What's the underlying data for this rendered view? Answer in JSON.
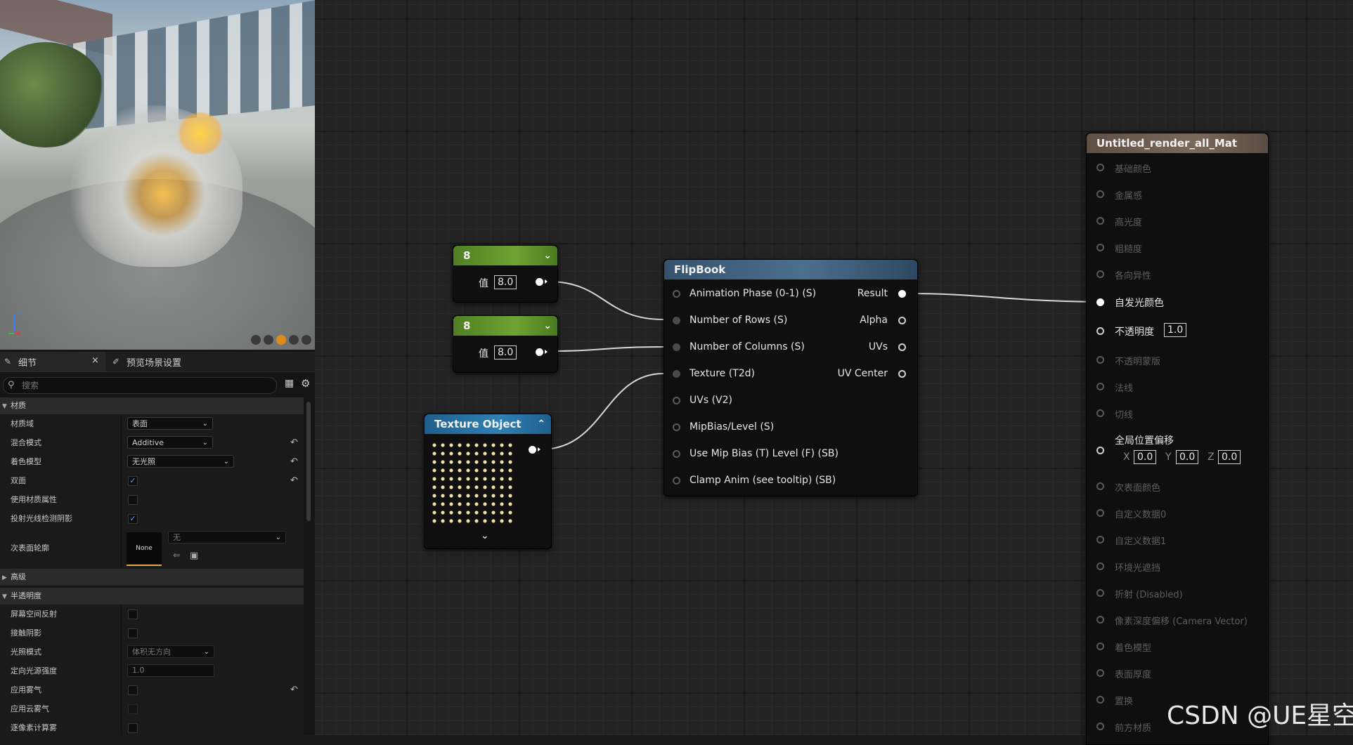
{
  "details_panel": {
    "tab_details": "细节",
    "tab_preview_scene": "预览场景设置",
    "search_placeholder": "搜索",
    "categories": {
      "material": "材质",
      "advanced": "高级",
      "translucency": "半透明度"
    },
    "rows": {
      "material_domain": {
        "label": "材质域",
        "value": "表面"
      },
      "blend_mode": {
        "label": "混合模式",
        "value": "Additive"
      },
      "shading_model": {
        "label": "着色模型",
        "value": "无光照"
      },
      "two_sided": {
        "label": "双面",
        "checked": true
      },
      "use_material_attributes": {
        "label": "使用材质属性",
        "checked": false
      },
      "cast_ray_traced_shadows": {
        "label": "投射光线检测阴影",
        "checked": true
      },
      "subsurface_profile": {
        "label": "次表面轮廓",
        "thumb": "None",
        "value": "无"
      },
      "screen_space_reflections": {
        "label": "屏幕空间反射",
        "checked": false
      },
      "contact_shadows": {
        "label": "接触阴影",
        "checked": false
      },
      "lighting_mode": {
        "label": "光照模式",
        "value": "体积无方向"
      },
      "directional_light_intensity": {
        "label": "定向光源强度",
        "value": "1.0"
      },
      "apply_fogging": {
        "label": "应用雾气",
        "checked": false
      },
      "apply_cloud_fogging": {
        "label": "应用云雾气",
        "checked": false
      },
      "per_pixel_fogging": {
        "label": "逐像素计算雾"
      }
    }
  },
  "graph": {
    "const1": {
      "title": "8",
      "label": "值",
      "value": "8.0"
    },
    "const2": {
      "title": "8",
      "label": "值",
      "value": "8.0"
    },
    "texture_object": {
      "title": "Texture Object"
    },
    "flipbook": {
      "title": "FlipBook",
      "inputs": [
        "Animation  Phase (0-1) (S)",
        "Number of Rows (S)",
        "Number of Columns (S)",
        "Texture (T2d)",
        "UVs (V2)",
        "MipBias/Level (S)",
        "Use Mip Bias (T) Level (F) (SB)",
        "Clamp Anim (see tooltip) (SB)"
      ],
      "outputs": [
        "Result",
        "Alpha",
        "UVs",
        "UV Center"
      ]
    },
    "material_node": {
      "title": "Untitled_render_all_Mat",
      "pins": [
        "基础颜色",
        "金属感",
        "高光度",
        "粗糙度",
        "各向异性",
        "自发光颜色",
        "不透明度",
        "不透明蒙版",
        "法线",
        "切线",
        "全局位置偏移",
        "次表面颜色",
        "自定义数据0",
        "自定义数据1",
        "环境光遮挡",
        "折射 (Disabled)",
        "像素深度偏移 (Camera Vector)",
        "着色模型",
        "表面厚度",
        "置换",
        "前方材质"
      ],
      "opacity_value": "1.0",
      "wpo": {
        "x_label": "X",
        "x": "0.0",
        "y_label": "Y",
        "y": "0.0",
        "z_label": "Z",
        "z": "0.0"
      }
    }
  },
  "watermark": "CSDN @UE星空",
  "colors": {
    "constant_header": "#5f8f2c",
    "texture_header": "#2a6f99",
    "flipbook_header": "#3d5d7a",
    "material_header": "#6a5a4f",
    "accent": "#e8a53c"
  }
}
